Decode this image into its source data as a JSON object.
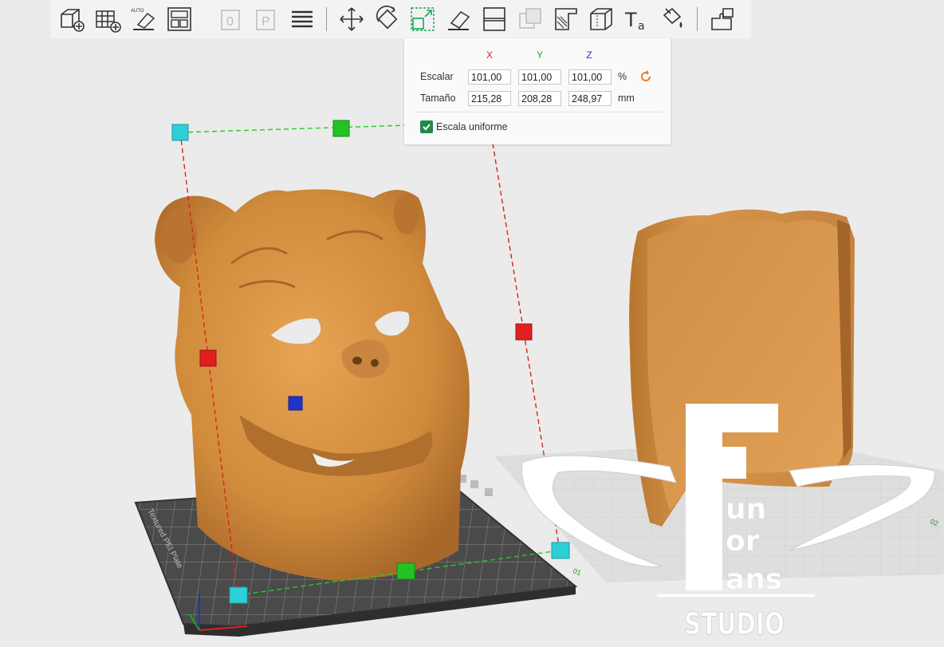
{
  "toolbar": {
    "buttons": [
      {
        "name": "add-object-icon",
        "enabled": true
      },
      {
        "name": "add-plate-icon",
        "enabled": true
      },
      {
        "name": "auto-orient-icon",
        "enabled": true,
        "badge": "AUTO"
      },
      {
        "name": "arrange-icon",
        "enabled": true
      },
      {
        "name": "split-objects-icon",
        "enabled": false,
        "badge": "0"
      },
      {
        "name": "split-parts-icon",
        "enabled": false,
        "badge": "P"
      },
      {
        "name": "layers-icon",
        "enabled": true
      },
      {
        "name": "move-icon",
        "enabled": true
      },
      {
        "name": "rotate-icon",
        "enabled": true
      },
      {
        "name": "scale-icon",
        "enabled": true,
        "active": true
      },
      {
        "name": "lay-on-face-icon",
        "enabled": true
      },
      {
        "name": "cut-icon",
        "enabled": true
      },
      {
        "name": "boolean-icon",
        "enabled": false
      },
      {
        "name": "support-paint-icon",
        "enabled": true
      },
      {
        "name": "seam-paint-icon",
        "enabled": true
      },
      {
        "name": "text-emboss-icon",
        "enabled": true
      },
      {
        "name": "color-paint-icon",
        "enabled": true
      },
      {
        "name": "assembly-icon",
        "enabled": true
      }
    ]
  },
  "scale_panel": {
    "axes": {
      "x": "X",
      "y": "Y",
      "z": "Z"
    },
    "axis_colors": {
      "x": "#e02020",
      "y": "#1fa81f",
      "z": "#2233cc"
    },
    "scale_label": "Escalar",
    "scale_values": {
      "x": "101,00",
      "y": "101,00",
      "z": "101,00"
    },
    "scale_unit": "%",
    "size_label": "Tamaño",
    "size_values": {
      "x": "215,28",
      "y": "208,28",
      "z": "248,97"
    },
    "size_unit": "mm",
    "uniform_scale_label": "Escala uniforme",
    "uniform_scale_checked": true
  },
  "viewport": {
    "model_color": "#d4913f",
    "bed_label": "Textured PEI Plate",
    "plate_number": "01",
    "plate2_number": "02"
  },
  "watermark": {
    "letter_large": "F",
    "line1": "un",
    "line2": "or",
    "line3": "ans",
    "studio": "STUDIO"
  }
}
